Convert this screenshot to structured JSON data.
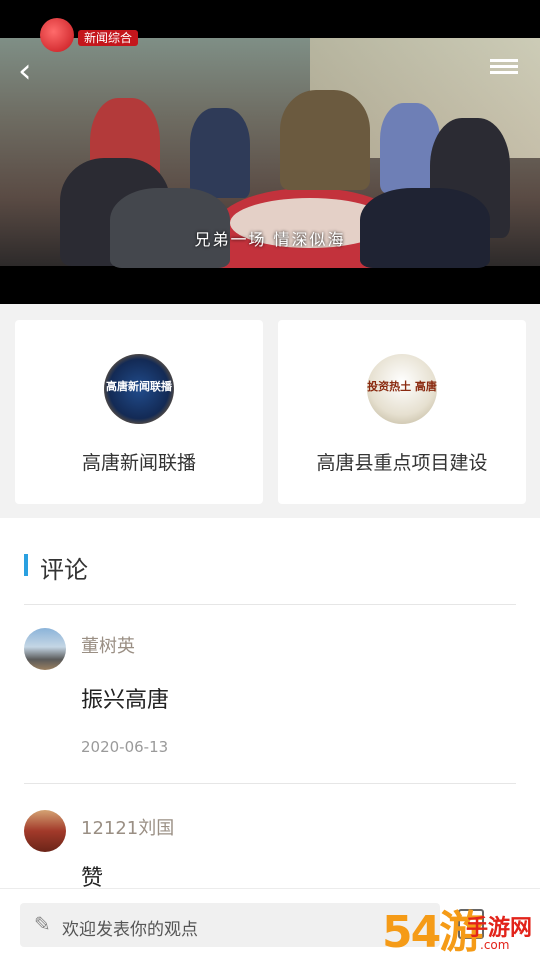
{
  "video": {
    "channel_tag": "新闻综合",
    "subtitle": "兄弟一场 情深似海",
    "icons": {
      "back": "back-arrow-icon",
      "menu": "menu-icon",
      "logo": "station-logo-icon"
    }
  },
  "programs": [
    {
      "label": "高唐新闻联播",
      "thumb_text": "高唐新闻联播"
    },
    {
      "label": "高唐县重点项目建设",
      "thumb_text": "投资热土 高唐"
    }
  ],
  "comments_section": {
    "title": "评论",
    "items": [
      {
        "name": "董树英",
        "text": "振兴高唐",
        "date": "2020-06-13"
      },
      {
        "name": "12121刘国",
        "text": "赞",
        "date": ""
      }
    ]
  },
  "bottom_bar": {
    "placeholder": "欢迎发表你的观点",
    "icons": {
      "edit": "pencil-icon",
      "share": "share-icon"
    }
  },
  "watermark": {
    "text": "54游",
    "small": "手游网",
    "domain": ".com"
  },
  "colors": {
    "accent": "#2aa0e0",
    "name": "#9a8f84",
    "date": "#9a9a9a"
  }
}
